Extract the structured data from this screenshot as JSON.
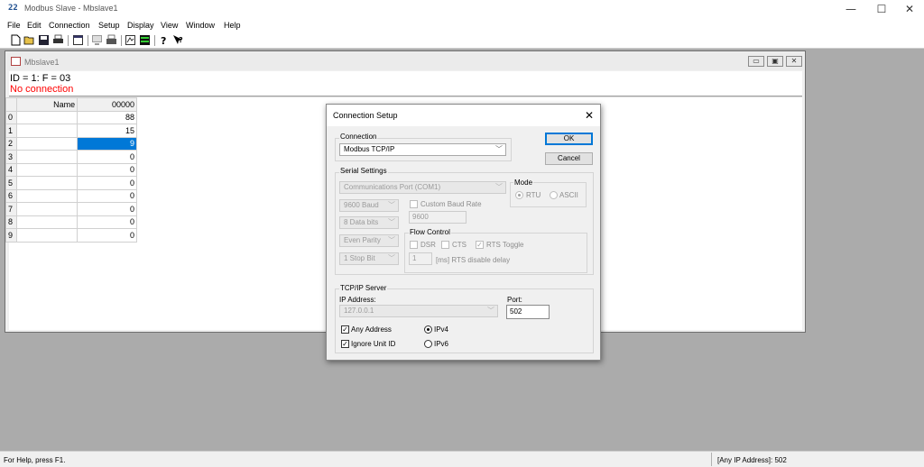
{
  "window": {
    "title": "Modbus Slave - Mbslave1",
    "app_icon": "22",
    "minimize": "—",
    "maximize": "☐",
    "close": "✕"
  },
  "menu": [
    "File",
    "Edit",
    "Connection",
    "Setup",
    "Display",
    "View",
    "Window",
    "Help"
  ],
  "child": {
    "title": "Mbslave1",
    "id_line": "ID = 1: F = 03",
    "status": "No connection",
    "status_color": "#ff0000",
    "columns": {
      "name": "Name",
      "address": "00000"
    },
    "rows": [
      {
        "index": "0",
        "name": "",
        "value": "88"
      },
      {
        "index": "1",
        "name": "",
        "value": "15"
      },
      {
        "index": "2",
        "name": "",
        "value": "9"
      },
      {
        "index": "3",
        "name": "",
        "value": "0"
      },
      {
        "index": "4",
        "name": "",
        "value": "0"
      },
      {
        "index": "5",
        "name": "",
        "value": "0"
      },
      {
        "index": "6",
        "name": "",
        "value": "0"
      },
      {
        "index": "7",
        "name": "",
        "value": "0"
      },
      {
        "index": "8",
        "name": "",
        "value": "0"
      },
      {
        "index": "9",
        "name": "",
        "value": "0"
      }
    ],
    "selected_row": "2",
    "selection_color": "#0078d7"
  },
  "dialog": {
    "title": "Connection Setup",
    "connection_label": "Connection",
    "connection_value": "Modbus TCP/IP",
    "ok": "OK",
    "cancel": "Cancel",
    "serial_label": "Serial Settings",
    "port": "Communications Port (COM1)",
    "baud": "9600 Baud",
    "data_bits": "8 Data bits",
    "parity": "Even Parity",
    "stop_bits": "1 Stop Bit",
    "mode_label": "Mode",
    "mode_rtu": "RTU",
    "mode_ascii": "ASCII",
    "custom_baud_label": "Custom Baud Rate",
    "custom_baud_value": "9600",
    "flow_label": "Flow Control",
    "dsr": "DSR",
    "cts": "CTS",
    "rts_toggle": "RTS Toggle",
    "rts_delay_value": "1",
    "rts_delay_label": "[ms] RTS disable delay",
    "tcp_label": "TCP/IP Server",
    "ip_label": "IP Address:",
    "ip_value": "127.0.0.1",
    "port_label": "Port:",
    "port_value": "502",
    "any_address": "Any Address",
    "ignore_unit": "Ignore Unit ID",
    "ipv4": "IPv4",
    "ipv6": "IPv6",
    "close_glyph": "✕",
    "dropdown_glyph": "﹀"
  },
  "statusbar": {
    "help": "For Help, press F1.",
    "ip": "[Any IP Address]: 502"
  }
}
